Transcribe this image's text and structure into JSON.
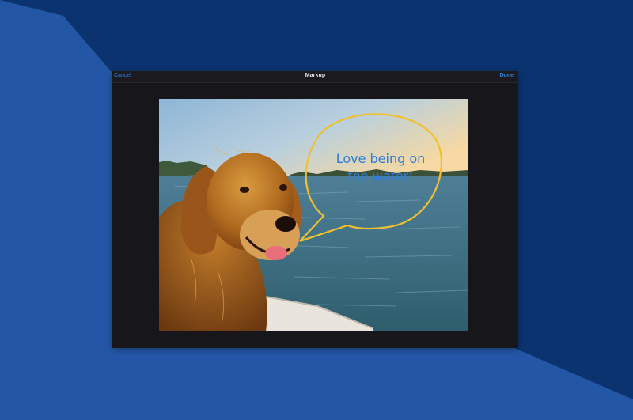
{
  "window": {
    "title": "Markup",
    "cancel_label": "Cancel",
    "done_label": "Done"
  },
  "annotation": {
    "text_line1": "Love being on",
    "text_line2": "the water!",
    "text_color": "#2e7bd9",
    "bubble_color": "#f0c030"
  },
  "colors": {
    "background_dark": "#0b3370",
    "background_light": "#2458a8",
    "accent_blue": "#2f7fe8"
  }
}
